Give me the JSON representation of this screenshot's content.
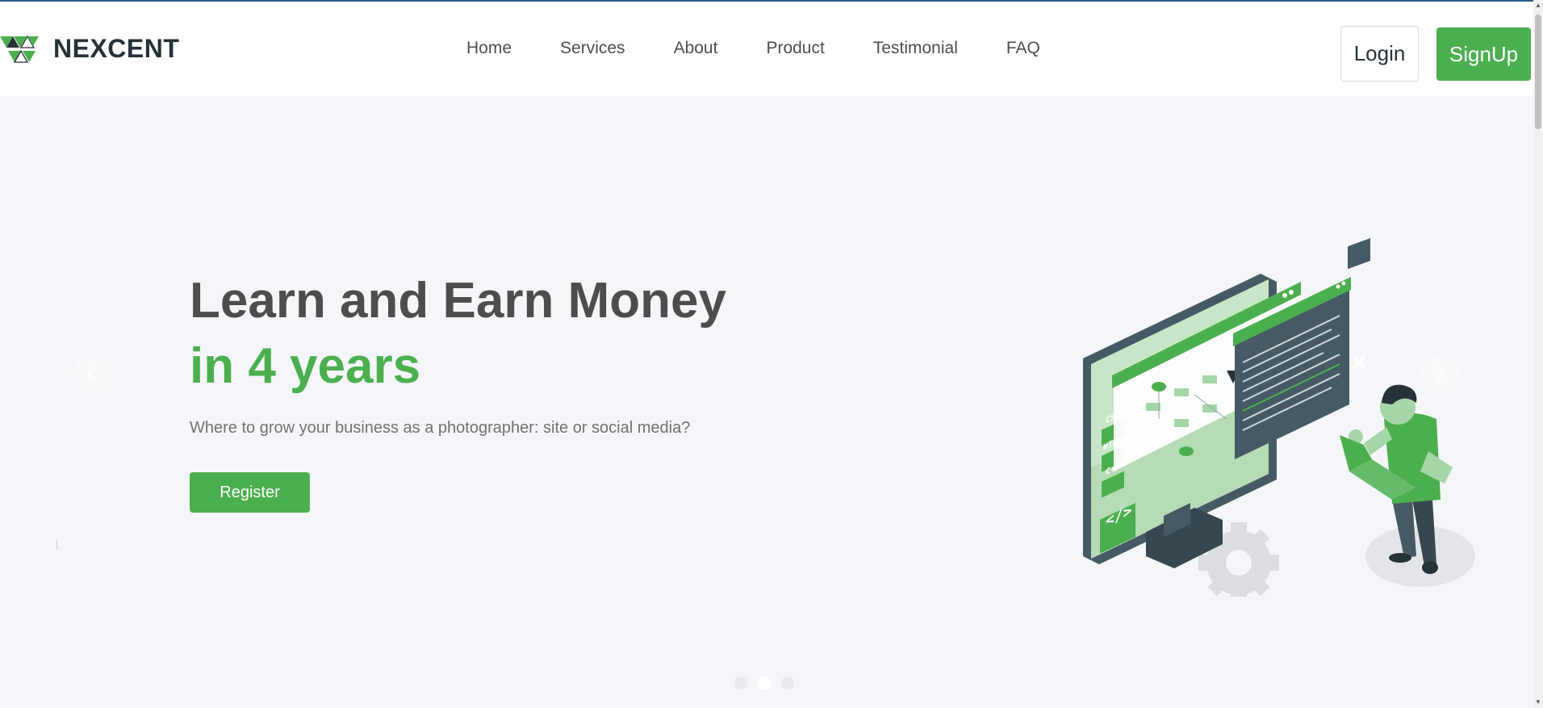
{
  "brand": {
    "name": "NEXCENT",
    "accent": "#4caf4f",
    "dark": "#263238"
  },
  "nav": {
    "items": [
      {
        "label": "Home"
      },
      {
        "label": "Services"
      },
      {
        "label": "About"
      },
      {
        "label": "Product"
      },
      {
        "label": "Testimonial"
      },
      {
        "label": "FAQ"
      }
    ]
  },
  "auth": {
    "login_label": "Login",
    "signup_label": "SignUp"
  },
  "hero": {
    "headline": "Learn and Earn Money",
    "headline_highlight": "in 4 years",
    "subtitle": "Where to grow your business as a photographer: site or social media?",
    "cta_label": "Register",
    "slides": {
      "total": 3,
      "active": 2
    },
    "illustration": {
      "icons": [
        "monitor",
        "code-window",
        "person-with-laptop",
        "gear",
        "close-badge"
      ],
      "tags": [
        "CSS",
        "HTML",
        "C++"
      ]
    }
  },
  "icons": {
    "prev": "chevron-left-icon",
    "next": "chevron-right-icon"
  }
}
